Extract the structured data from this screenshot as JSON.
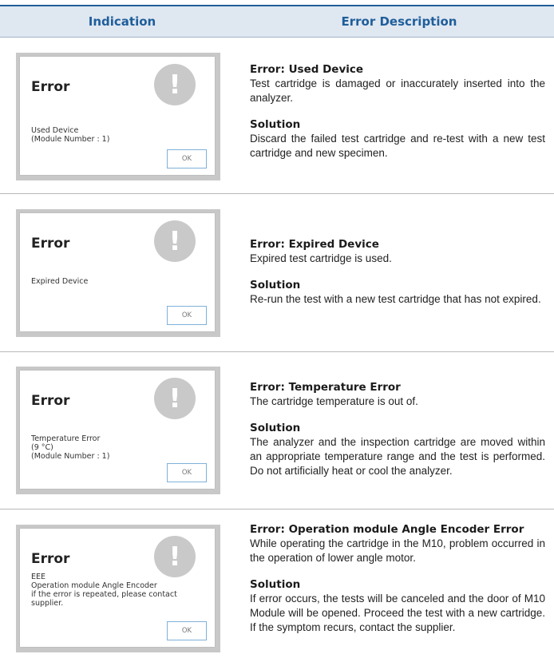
{
  "table": {
    "col_indication": "Indication",
    "col_description": "Error Description"
  },
  "icons": {
    "alert": "exclamation-circle-icon"
  },
  "colors": {
    "heading_blue": "#1f5e9a",
    "header_bg": "#dfe7f1",
    "ok_border": "#7fb1d9"
  },
  "rows": [
    {
      "dialog": {
        "title": "Error",
        "message": "Used Device\n(Module Number : 1)",
        "icon_glyph": "!",
        "ok": "OK"
      },
      "error_title": "Error: Used Device",
      "error_text": "Test cartridge is damaged or inaccurately inserted into the analyzer.",
      "solution_title": "Solution",
      "solution_text": "Discard the failed test cartridge and re-test with a new test cartridge and new specimen."
    },
    {
      "dialog": {
        "title": "Error",
        "message": "Expired Device",
        "icon_glyph": "!",
        "ok": "OK"
      },
      "error_title": "Error: Expired Device",
      "error_text": "Expired test cartridge is used.",
      "solution_title": "Solution",
      "solution_text": "Re-run the test with a new test cartridge that has not expired."
    },
    {
      "dialog": {
        "title": "Error",
        "message": "Temperature Error\n(9 °C)\n(Module Number : 1)",
        "icon_glyph": "!",
        "ok": "OK"
      },
      "error_title": "Error: Temperature Error",
      "error_text": "The cartridge temperature is out of.",
      "solution_title": "Solution",
      "solution_text": "The analyzer and the inspection cartridge are moved within an appropriate temperature range and the test is performed. Do not artificially heat or cool the analyzer."
    },
    {
      "dialog": {
        "title": "Error",
        "message": "EEE\nOperation module Angle Encoder\nif the error is repeated, please contact\nsupplier.",
        "icon_glyph": "!",
        "ok": "OK"
      },
      "error_title": "Error: Operation module Angle Encoder Error",
      "error_text": "While operating the cartridge in the M10, problem occurred in the operation of lower angle motor.",
      "solution_title": "Solution",
      "solution_text": "If error occurs, the tests will be canceled and the door of M10 Module will be opened. Proceed the test with a new cartridge. If the symptom recurs, contact the supplier."
    }
  ]
}
